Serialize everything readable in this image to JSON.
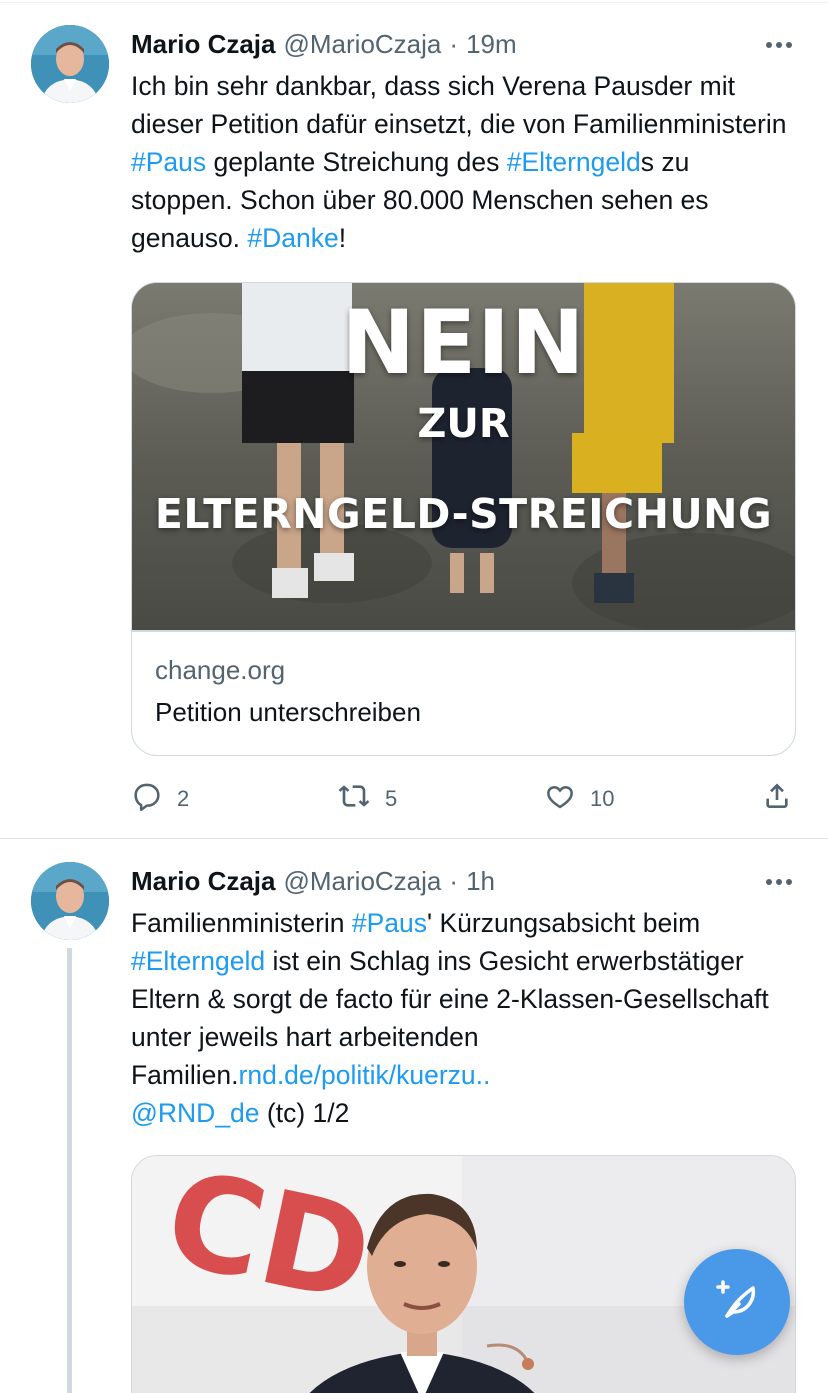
{
  "colors": {
    "accent": "#1d9bf0",
    "secondary_text": "#536471",
    "fab": "#4a99e9"
  },
  "tweets": [
    {
      "author": {
        "name": "Mario Czaja",
        "handle": "@MarioCzaja"
      },
      "separator": "·",
      "time": "19m",
      "text_parts": [
        {
          "t": "Ich bin sehr dankbar, dass sich Verena Pausder mit dieser Petition dafür einsetzt, die von Familienministerin "
        },
        {
          "t": "#Paus"
        },
        {
          "t": " geplante Streichung des "
        },
        {
          "t": "#Elterngeld"
        },
        {
          "t": "s zu stoppen. Schon über 80.000 Menschen sehen es genauso. "
        },
        {
          "t": "#Danke"
        },
        {
          "t": "!"
        }
      ],
      "card": {
        "image_text": {
          "line1": "NEIN",
          "line2": "ZUR",
          "line3": "ELTERNGELD-STREICHUNG"
        },
        "domain": "change.org",
        "title": "Petition unterschreiben"
      },
      "actions": {
        "replies": "2",
        "retweets": "5",
        "likes": "10"
      }
    },
    {
      "author": {
        "name": "Mario Czaja",
        "handle": "@MarioCzaja"
      },
      "separator": "·",
      "time": "1h",
      "text_parts": [
        {
          "t": "Familienministerin "
        },
        {
          "t": "#Paus"
        },
        {
          "t": "' Kürzungsabsicht beim "
        },
        {
          "t": "#Elterngeld"
        },
        {
          "t": " ist ein Schlag ins Gesicht erwerbstätiger Eltern & sorgt de facto für eine 2-Klassen-Gesellschaft unter jeweils hart arbeitenden Familien."
        },
        {
          "t": "rnd.de/politik/kuerzu.."
        },
        {
          "t": " "
        },
        {
          "t": "@RND_de"
        },
        {
          "t": " (tc) 1/2"
        }
      ],
      "media": {
        "logo_text": "CDU"
      }
    }
  ],
  "icons": {
    "more": "more-horizontal-icon",
    "reply": "reply-icon",
    "retweet": "retweet-icon",
    "like": "heart-icon",
    "share": "share-icon",
    "compose": "compose-tweet-icon"
  }
}
